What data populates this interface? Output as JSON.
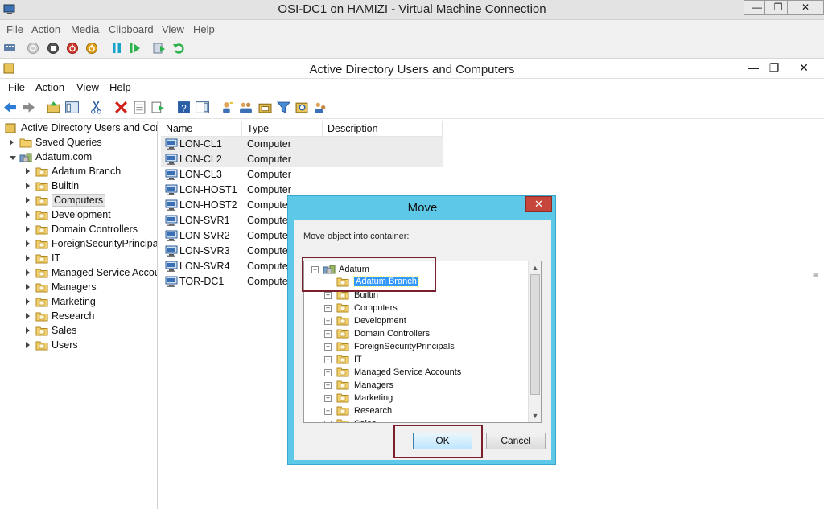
{
  "vm_window": {
    "title": "OSI-DC1 on HAMIZI - Virtual Machine Connection",
    "minimize": "—",
    "maximize": "❐",
    "close": "✕",
    "menu": [
      "File",
      "Action",
      "Media",
      "Clipboard",
      "View",
      "Help"
    ]
  },
  "aduc_window": {
    "title": "Active Directory Users and Computers",
    "minimize": "—",
    "restore": "❐",
    "close": "✕",
    "menu": [
      "File",
      "Action",
      "View",
      "Help"
    ]
  },
  "tree": {
    "root": "Active Directory Users and Com",
    "items": [
      {
        "label": "Saved Queries",
        "level": 1,
        "expanded": false
      },
      {
        "label": "Adatum.com",
        "level": 1,
        "expanded": true
      },
      {
        "label": "Adatum Branch",
        "level": 2
      },
      {
        "label": "Builtin",
        "level": 2
      },
      {
        "label": "Computers",
        "level": 2,
        "selected": true
      },
      {
        "label": "Development",
        "level": 2
      },
      {
        "label": "Domain Controllers",
        "level": 2
      },
      {
        "label": "ForeignSecurityPrincipal:",
        "level": 2
      },
      {
        "label": "IT",
        "level": 2
      },
      {
        "label": "Managed Service Accour",
        "level": 2
      },
      {
        "label": "Managers",
        "level": 2
      },
      {
        "label": "Marketing",
        "level": 2
      },
      {
        "label": "Research",
        "level": 2
      },
      {
        "label": "Sales",
        "level": 2
      },
      {
        "label": "Users",
        "level": 2
      }
    ]
  },
  "list": {
    "columns": [
      "Name",
      "Type",
      "Description"
    ],
    "rows": [
      {
        "name": "LON-CL1",
        "type": "Computer",
        "highlight": true
      },
      {
        "name": "LON-CL2",
        "type": "Computer",
        "highlight": true
      },
      {
        "name": "LON-CL3",
        "type": "Computer"
      },
      {
        "name": "LON-HOST1",
        "type": "Computer"
      },
      {
        "name": "LON-HOST2",
        "type": "Compute"
      },
      {
        "name": "LON-SVR1",
        "type": "Compute"
      },
      {
        "name": "LON-SVR2",
        "type": "Compute"
      },
      {
        "name": "LON-SVR3",
        "type": "Compute"
      },
      {
        "name": "LON-SVR4",
        "type": "Compute"
      },
      {
        "name": "TOR-DC1",
        "type": "Compute"
      }
    ]
  },
  "dialog": {
    "title": "Move",
    "close": "✕",
    "prompt": "Move object into container:",
    "root": "Adatum",
    "items": [
      {
        "label": "Adatum Branch",
        "selected": true
      },
      {
        "label": "Builtin"
      },
      {
        "label": "Computers"
      },
      {
        "label": "Development"
      },
      {
        "label": "Domain Controllers"
      },
      {
        "label": "ForeignSecurityPrincipals"
      },
      {
        "label": "IT"
      },
      {
        "label": "Managed Service Accounts"
      },
      {
        "label": "Managers"
      },
      {
        "label": "Marketing"
      },
      {
        "label": "Research"
      },
      {
        "label": "Sales"
      }
    ],
    "ok": "OK",
    "cancel": "Cancel",
    "scroll_up": "▲",
    "scroll_down": "▼"
  },
  "scroll_grip": "≡",
  "colors": {
    "dialog_frame": "#5ec8e8",
    "selection": "#3399ff",
    "close_red": "#c7463b",
    "annotation_box": "#7a1f2b"
  }
}
